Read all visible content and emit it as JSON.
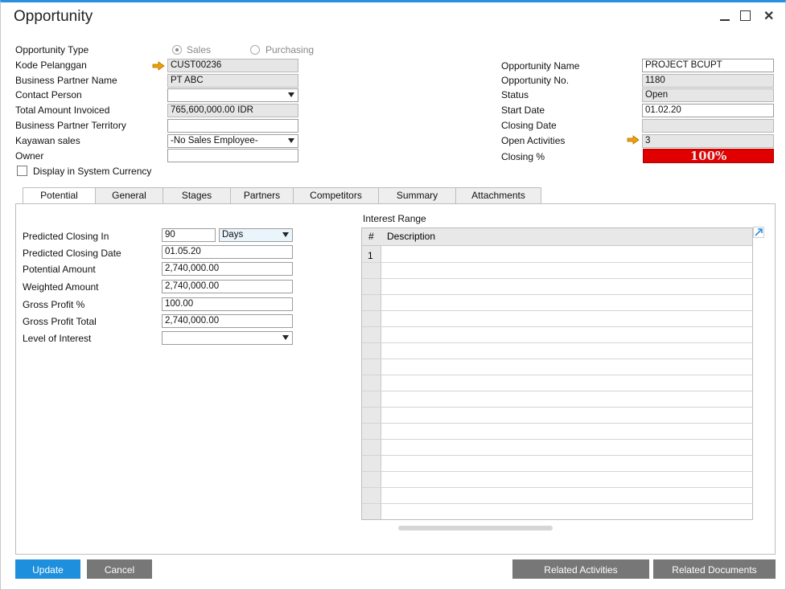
{
  "window": {
    "title": "Opportunity"
  },
  "form": {
    "opportunity_type": {
      "label": "Opportunity Type",
      "options": [
        "Sales",
        "Purchasing"
      ],
      "selected": "Sales"
    },
    "kode_pelanggan": {
      "label": "Kode Pelanggan",
      "value": "CUST00236"
    },
    "bp_name": {
      "label": "Business Partner Name",
      "value": "PT ABC"
    },
    "contact_person": {
      "label": "Contact Person",
      "value": ""
    },
    "total_invoiced": {
      "label": "Total Amount Invoiced",
      "value": "765,600,000.00 IDR"
    },
    "bp_territory": {
      "label": "Business Partner Territory",
      "value": ""
    },
    "kayawan_sales": {
      "label": "Kayawan sales",
      "value": "-No Sales Employee-"
    },
    "owner": {
      "label": "Owner",
      "value": ""
    },
    "display_currency": {
      "label": "Display in System Currency",
      "checked": false
    },
    "opportunity_name": {
      "label": "Opportunity Name",
      "value": "PROJECT BCUPT"
    },
    "opportunity_no": {
      "label": "Opportunity No.",
      "value": "1180"
    },
    "status": {
      "label": "Status",
      "value": "Open"
    },
    "start_date": {
      "label": "Start Date",
      "value": "01.02.20"
    },
    "closing_date": {
      "label": "Closing Date",
      "value": ""
    },
    "open_activities": {
      "label": "Open Activities",
      "value": "3"
    },
    "closing_pct": {
      "label": "Closing %",
      "value": "100%",
      "bar_color": "#e00000"
    }
  },
  "tabs": [
    {
      "label": "Potential",
      "active": true
    },
    {
      "label": "General",
      "active": false
    },
    {
      "label": "Stages",
      "active": false
    },
    {
      "label": "Partners",
      "active": false
    },
    {
      "label": "Competitors",
      "active": false
    },
    {
      "label": "Summary",
      "active": false
    },
    {
      "label": "Attachments",
      "active": false
    }
  ],
  "potential": {
    "predicted_closing_in": {
      "label": "Predicted Closing In",
      "value": "90",
      "unit": "Days"
    },
    "predicted_closing_date": {
      "label": "Predicted Closing Date",
      "value": "01.05.20"
    },
    "potential_amount": {
      "label": "Potential Amount",
      "value": "2,740,000.00"
    },
    "weighted_amount": {
      "label": "Weighted Amount",
      "value": "2,740,000.00"
    },
    "gross_profit_pct": {
      "label": "Gross Profit %",
      "value": "100.00"
    },
    "gross_profit_total": {
      "label": "Gross Profit Total",
      "value": "2,740,000.00"
    },
    "level_of_interest": {
      "label": "Level of Interest",
      "value": ""
    }
  },
  "interest_range": {
    "title": "Interest Range",
    "columns": [
      "#",
      "Description"
    ],
    "rows": [
      {
        "num": "1",
        "description": ""
      }
    ]
  },
  "buttons": {
    "update": "Update",
    "cancel": "Cancel",
    "related_activities": "Related Activities",
    "related_documents": "Related Documents"
  },
  "colors": {
    "accent": "#1d8fdc",
    "title_border": "#2b8fe0",
    "link_arrow": "#f0a000"
  }
}
